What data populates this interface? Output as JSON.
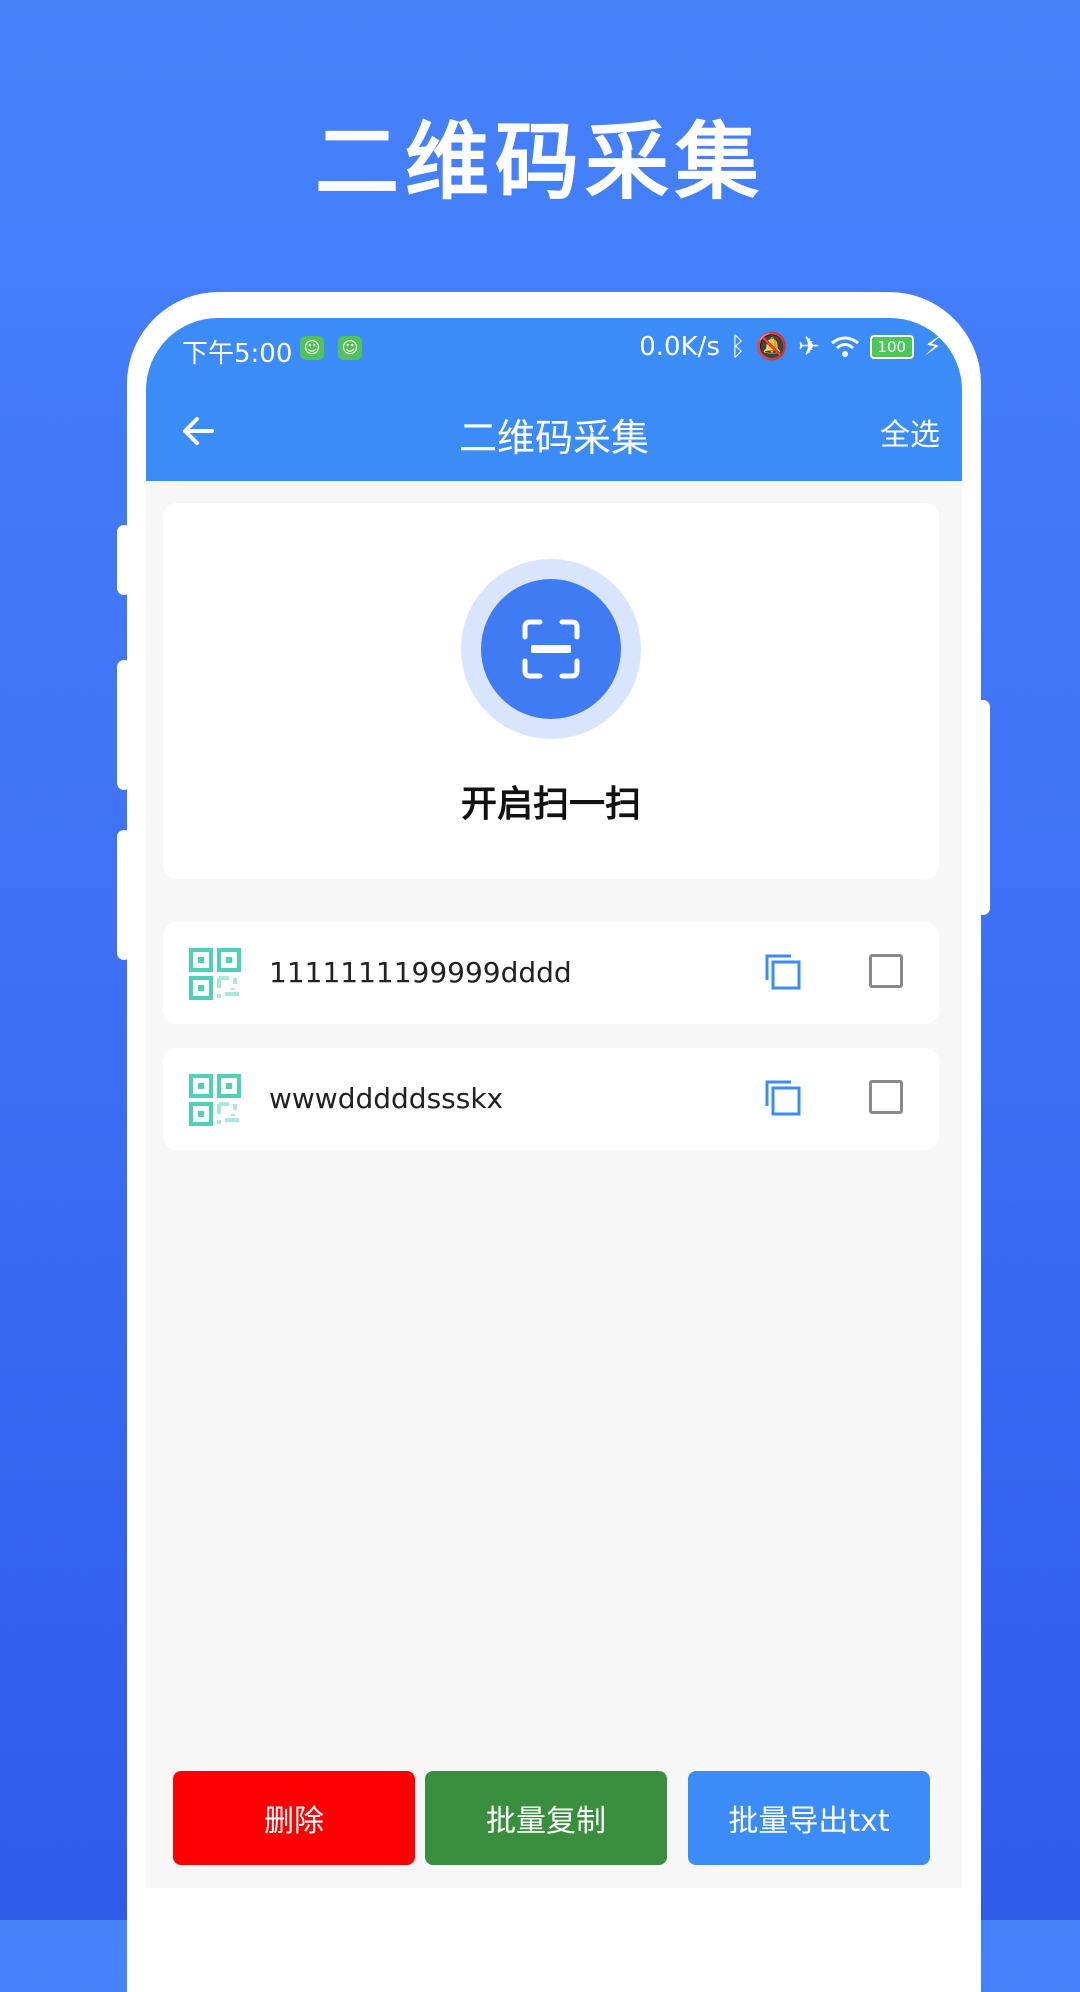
{
  "promo": {
    "title": "二维码采集"
  },
  "status_bar": {
    "time": "下午5:00",
    "network_speed": "0.0K/s",
    "battery": "100"
  },
  "nav": {
    "title": "二维码采集",
    "select_all": "全选",
    "back_icon": "arrow-left-icon"
  },
  "scan": {
    "label": "开启扫一扫",
    "icon": "scan-icon"
  },
  "items": [
    {
      "text": "1111111199999dddd"
    },
    {
      "text": "wwwdddddssskx"
    }
  ],
  "buttons": {
    "delete": "删除",
    "batch_copy": "批量复制",
    "batch_export": "批量导出txt"
  },
  "colors": {
    "primary": "#3c8cf8",
    "delete": "#ff0000",
    "copy": "#3a8f3e",
    "export": "#3c8cf8",
    "qr": "#4fd1b7"
  }
}
